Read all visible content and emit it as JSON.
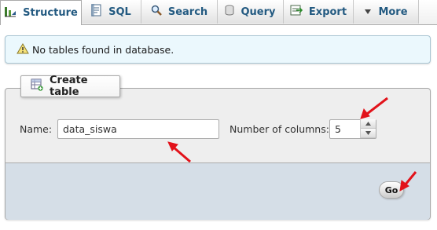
{
  "tabs": [
    {
      "label": "Structure",
      "icon": "structure-icon",
      "active": true
    },
    {
      "label": "SQL",
      "icon": "sql-icon",
      "active": false
    },
    {
      "label": "Search",
      "icon": "search-icon",
      "active": false
    },
    {
      "label": "Query",
      "icon": "query-icon",
      "active": false
    },
    {
      "label": "Export",
      "icon": "export-icon",
      "active": false
    },
    {
      "label": "More",
      "icon": "chevron-down-icon",
      "active": false
    }
  ],
  "notice": {
    "text": "No tables found in database.",
    "icon": "warning-icon"
  },
  "create_table": {
    "legend": "Create table",
    "legend_icon": "create-table-icon",
    "name_label": "Name:",
    "name_value": "data_siswa",
    "columns_label": "Number of columns:",
    "columns_value": "5",
    "go_label": "Go"
  },
  "colors": {
    "tab_text": "#235a81",
    "notice_bg": "#ebf8fd",
    "panel_bg": "#eeeeee",
    "footer_bg": "#d5dee7",
    "annotation_arrow": "#e2121a"
  }
}
